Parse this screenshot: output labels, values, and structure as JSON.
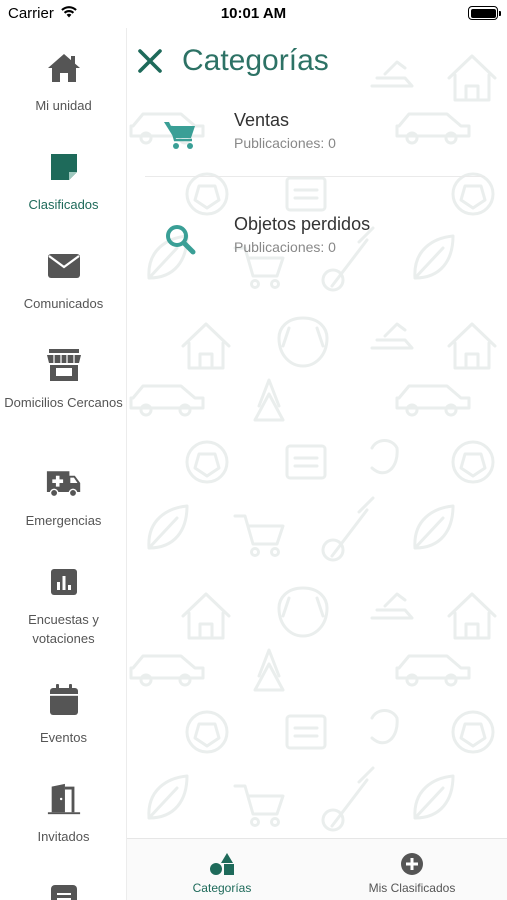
{
  "status": {
    "carrier": "Carrier",
    "time": "10:01 AM"
  },
  "sidebar": {
    "items": [
      {
        "label": "Mi unidad",
        "icon": "home-icon",
        "active": false
      },
      {
        "label": "Clasificados",
        "icon": "sticky-note-icon",
        "active": true
      },
      {
        "label": "Comunicados",
        "icon": "envelope-icon",
        "active": false
      },
      {
        "label": "Domicilios Cercanos",
        "icon": "storefront-icon",
        "active": false
      },
      {
        "label": "Emergencias",
        "icon": "ambulance-icon",
        "active": false
      },
      {
        "label": "Encuestas y votaciones",
        "icon": "bar-chart-icon",
        "active": false
      },
      {
        "label": "Eventos",
        "icon": "calendar-icon",
        "active": false
      },
      {
        "label": "Invitados",
        "icon": "door-icon",
        "active": false
      },
      {
        "label": "",
        "icon": "message-icon",
        "active": false
      }
    ]
  },
  "header": {
    "title": "Categorías"
  },
  "categories": [
    {
      "name": "Ventas",
      "count": "Publicaciones: 0",
      "icon": "cart-icon"
    },
    {
      "name": "Objetos perdidos",
      "count": "Publicaciones: 0",
      "icon": "search-icon"
    }
  ],
  "tabs": [
    {
      "label": "Categorías",
      "icon": "shapes-icon",
      "active": true
    },
    {
      "label": "Mis Clasificados",
      "icon": "plus-circle-icon",
      "active": false
    }
  ],
  "colors": {
    "accent": "#2d7265",
    "active": "#1e6a5a",
    "icon_gray": "#555555",
    "category_icon": "#3a9f96"
  }
}
